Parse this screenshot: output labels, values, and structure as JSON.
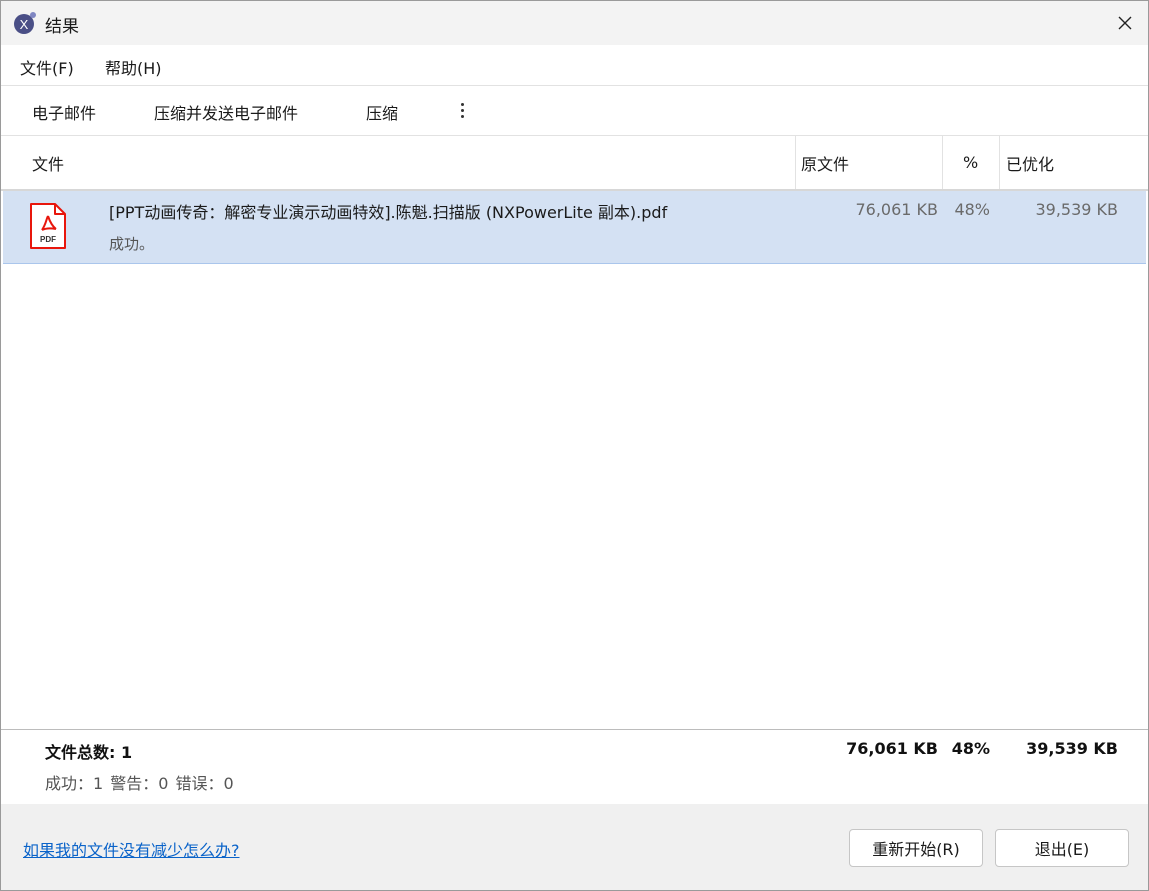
{
  "window": {
    "title": "结果"
  },
  "menu": {
    "items": [
      "文件(F)",
      "帮助(H)"
    ]
  },
  "toolbar": {
    "email": "电子邮件",
    "compress_email": "压缩并发送电子邮件",
    "compress": "压缩"
  },
  "columns": {
    "file": "文件",
    "original": "原文件",
    "percent": "%",
    "optimized": "已优化"
  },
  "files": [
    {
      "icon": "pdf-file-icon",
      "icon_label": "PDF",
      "name": "[PPT动画传奇：解密专业演示动画特效].陈魁.扫描版 (NXPowerLite 副本).pdf",
      "status": "成功。",
      "original": "76,061 KB",
      "percent": "48%",
      "optimized": "39,539 KB"
    }
  ],
  "summary": {
    "title": "文件总数: 1",
    "counts": "成功：1   警告：0   错误：0",
    "original": "76,061 KB",
    "percent": "48%",
    "optimized": "39,539 KB"
  },
  "footer": {
    "help_link": "如果我的文件没有减少怎么办?",
    "restart": "重新开始(R)",
    "exit": "退出(E)"
  },
  "colors": {
    "selection": "#d4e1f3",
    "link": "#0a63c9",
    "pdf_red": "#e8160c"
  }
}
